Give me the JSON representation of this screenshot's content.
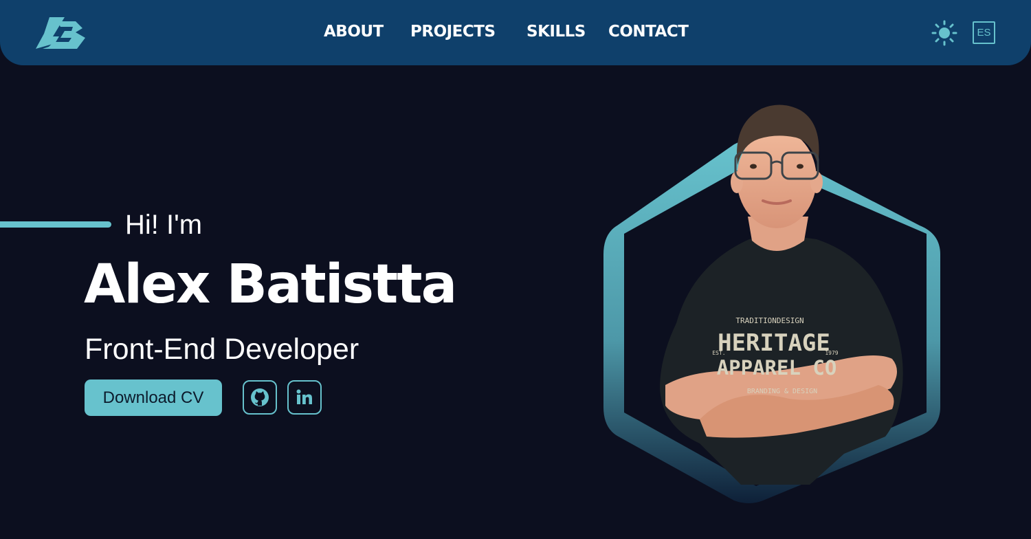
{
  "app": {
    "title": "Alex Batistta"
  },
  "header": {
    "logo_text": "AB",
    "nav": [
      {
        "label": "ABOUT"
      },
      {
        "label": "PROJECTS"
      },
      {
        "label": "SKILLS"
      },
      {
        "label": "CONTACT"
      }
    ],
    "theme_icon": "sun-icon",
    "language_label": "ES"
  },
  "hero": {
    "greeting": "Hi! I'm",
    "name": "Alex Batistta",
    "role": "Front-End Developer",
    "cv_button": "Download CV",
    "social": [
      {
        "icon": "github-icon"
      },
      {
        "icon": "linkedin-icon"
      }
    ],
    "portrait": {
      "shirt_line1": "TRADITIONDESIGN",
      "shirt_line2": "HERITAGE",
      "shirt_line3": "APPAREL CO",
      "shirt_line4": "BRANDING & DESIGN",
      "shirt_year_left": "EST.",
      "shirt_year_right": "1979"
    }
  },
  "colors": {
    "background": "#0c0f1f",
    "header": "#0f406b",
    "accent": "#67c2cd",
    "text": "#ffffff"
  }
}
